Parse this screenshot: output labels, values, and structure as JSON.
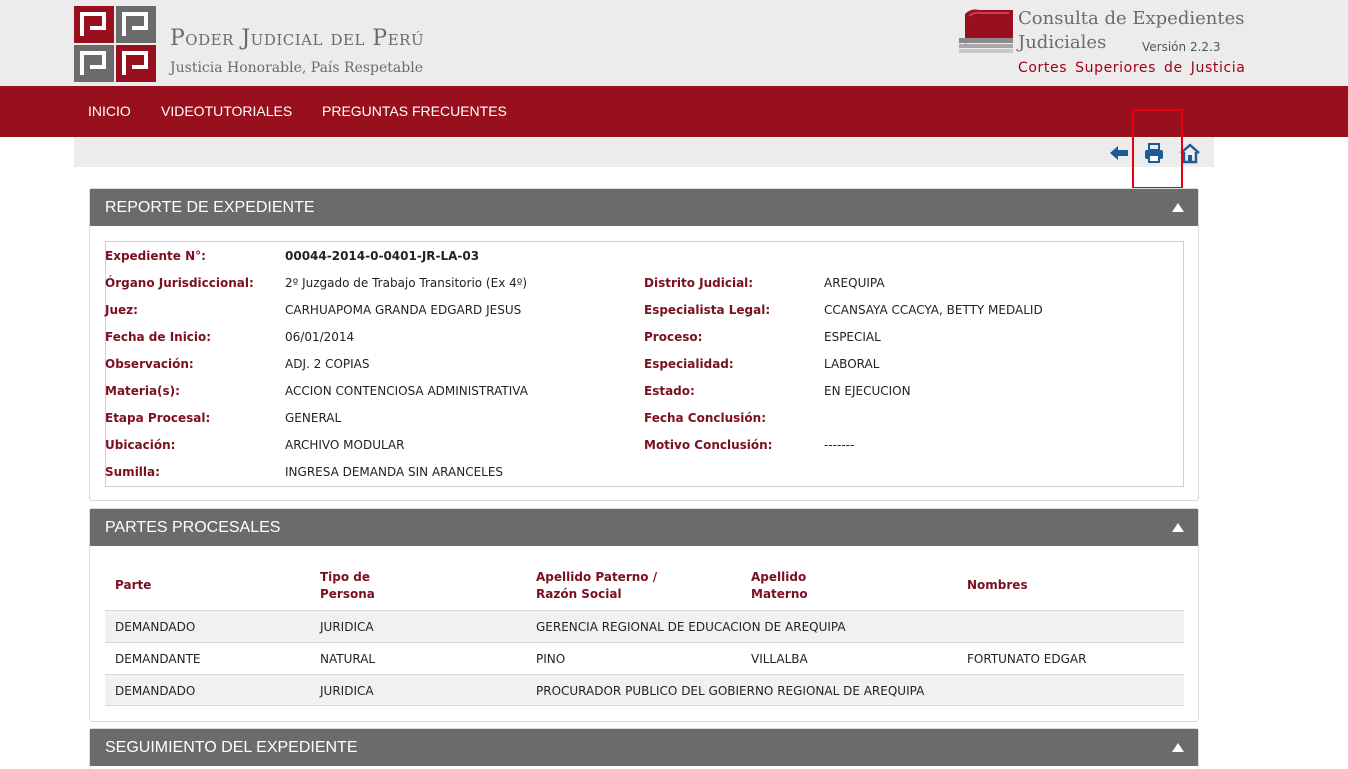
{
  "header": {
    "brand_name": "Poder Judicial del Perú",
    "brand_tagline": "Justicia Honorable, País Respetable",
    "app_title_line1": "Consulta de Expedientes",
    "app_title_line2": "Judiciales",
    "app_version": "Versión 2.2.3",
    "app_subtitle": "Cortes Superiores de Justicia"
  },
  "nav": {
    "items": [
      {
        "label": "INICIO"
      },
      {
        "label": "VIDEOTUTORIALES"
      },
      {
        "label": "PREGUNTAS FRECUENTES"
      }
    ]
  },
  "toolbar": {
    "icons": [
      "back-arrow-icon",
      "print-icon",
      "home-icon"
    ]
  },
  "colors": {
    "brand_red": "#98101d",
    "panel_header": "#6b6b6b",
    "label_red": "#7a1020",
    "highlight": "#e8000c"
  },
  "reporte": {
    "title": "REPORTE DE EXPEDIENTE",
    "expediente_label": "Expediente N°:",
    "expediente_value": "00044-2014-0-0401-JR-LA-03",
    "left": [
      {
        "label": "Órgano Jurisdiccional:",
        "value": "2º Juzgado de Trabajo Transitorio (Ex 4º)"
      },
      {
        "label": "Juez:",
        "value": "CARHUAPOMA GRANDA EDGARD JESUS"
      },
      {
        "label": "Fecha de Inicio:",
        "value": "06/01/2014"
      },
      {
        "label": "Observación:",
        "value": "ADJ. 2 COPIAS"
      },
      {
        "label": "Materia(s):",
        "value": "ACCION CONTENCIOSA ADMINISTRATIVA"
      },
      {
        "label": "Etapa Procesal:",
        "value": "GENERAL"
      },
      {
        "label": "Ubicación:",
        "value": "ARCHIVO MODULAR"
      },
      {
        "label": "Sumilla:",
        "value": "INGRESA DEMANDA SIN ARANCELES"
      }
    ],
    "right": [
      {
        "label": "Distrito Judicial:",
        "value": "AREQUIPA"
      },
      {
        "label": "Especialista Legal:",
        "value": "CCANSAYA CCACYA, BETTY MEDALID"
      },
      {
        "label": "Proceso:",
        "value": "ESPECIAL"
      },
      {
        "label": "Especialidad:",
        "value": "LABORAL"
      },
      {
        "label": "Estado:",
        "value": "EN EJECUCION"
      },
      {
        "label": "Fecha Conclusión:",
        "value": ""
      },
      {
        "label": "Motivo Conclusión:",
        "value": "-------"
      }
    ]
  },
  "partes": {
    "title": "PARTES PROCESALES",
    "columns": [
      {
        "line1": "Parte",
        "line2": ""
      },
      {
        "line1": "Tipo de",
        "line2": "Persona"
      },
      {
        "line1": "Apellido Paterno /",
        "line2": "Razón Social"
      },
      {
        "line1": "Apellido",
        "line2": "Materno"
      },
      {
        "line1": "Nombres",
        "line2": ""
      }
    ],
    "rows": [
      [
        "DEMANDADO",
        "JURIDICA",
        "GERENCIA REGIONAL DE EDUCACION DE AREQUIPA",
        "",
        ""
      ],
      [
        "DEMANDANTE",
        "NATURAL",
        "PINO",
        "VILLALBA",
        "FORTUNATO EDGAR"
      ],
      [
        "DEMANDADO",
        "JURIDICA",
        "PROCURADOR PUBLICO DEL GOBIERNO REGIONAL DE AREQUIPA",
        "",
        ""
      ]
    ]
  },
  "seguimiento": {
    "title": "SEGUIMIENTO DEL EXPEDIENTE"
  }
}
